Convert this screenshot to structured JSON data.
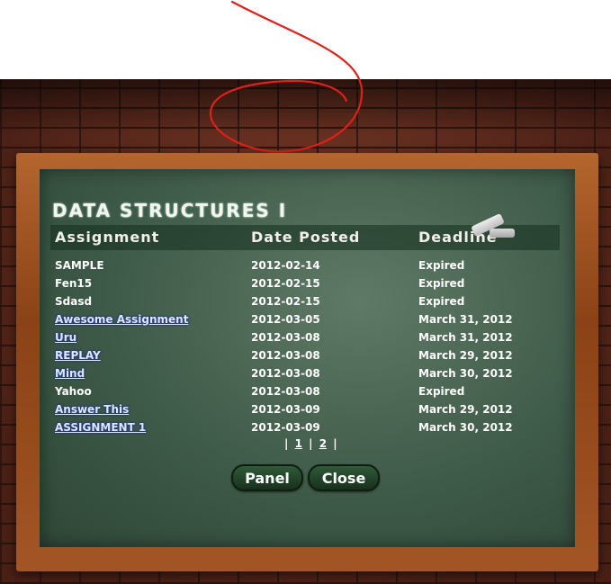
{
  "board": {
    "title": "DATA STRUCTURES I",
    "columns": [
      "Assignment",
      "Date Posted",
      "Deadline"
    ],
    "rows": [
      {
        "name": "SAMPLE",
        "posted": "2012-02-14",
        "deadline": "Expired",
        "link": false
      },
      {
        "name": "Fen15",
        "posted": "2012-02-15",
        "deadline": "Expired",
        "link": false
      },
      {
        "name": "Sdasd",
        "posted": "2012-02-15",
        "deadline": "Expired",
        "link": false
      },
      {
        "name": "Awesome Assignment",
        "posted": "2012-03-05",
        "deadline": "March 31, 2012",
        "link": true
      },
      {
        "name": "Uru",
        "posted": "2012-03-08",
        "deadline": "March 31, 2012",
        "link": true
      },
      {
        "name": "REPLAY",
        "posted": "2012-03-08",
        "deadline": "March 29, 2012",
        "link": true
      },
      {
        "name": "Mind",
        "posted": "2012-03-08",
        "deadline": "March 30, 2012",
        "link": true
      },
      {
        "name": "Yahoo",
        "posted": "2012-03-08",
        "deadline": "Expired",
        "link": false
      },
      {
        "name": "Answer This",
        "posted": "2012-03-09",
        "deadline": "March 29, 2012",
        "link": true
      },
      {
        "name": "ASSIGNMENT 1",
        "posted": "2012-03-09",
        "deadline": "March 30, 2012",
        "link": true
      }
    ],
    "pagination": {
      "pages": [
        "1",
        "2"
      ],
      "separator": "|"
    },
    "buttons": {
      "panel": "Panel",
      "close": "Close"
    }
  },
  "colors": {
    "chalkboard": "#3e5a48",
    "frame": "#8b4216",
    "link_text": "#dfe8ff",
    "annotation": "#e0201a"
  }
}
